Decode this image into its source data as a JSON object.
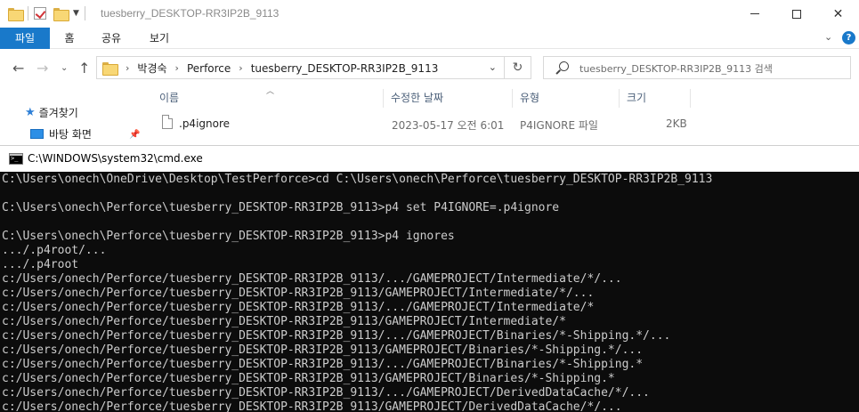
{
  "explorer": {
    "title": "tuesberry_DESKTOP-RR3IP2B_9113",
    "ribbon_tabs": [
      "파일",
      "홈",
      "공유",
      "보기"
    ],
    "address": {
      "crumbs": [
        "박경숙",
        "Perforce",
        "tuesberry_DESKTOP-RR3IP2B_9113"
      ]
    },
    "search": {
      "placeholder": "tuesberry_DESKTOP-RR3IP2B_9113 검색"
    },
    "nav": {
      "items": [
        {
          "label": "즐겨찾기",
          "icon": "star-icon"
        },
        {
          "label": "바탕 화면",
          "icon": "desktop-icon"
        }
      ]
    },
    "columns": [
      "이름",
      "수정한 날짜",
      "유형",
      "크기"
    ],
    "files": [
      {
        "name": ".p4ignore",
        "modified": "2023-05-17 오전 6:01",
        "type": "P4IGNORE 파일",
        "size": "2KB"
      }
    ]
  },
  "cmd": {
    "title": "C:\\WINDOWS\\system32\\cmd.exe",
    "lines": [
      "C:\\Users\\onech\\OneDrive\\Desktop\\TestPerforce>cd C:\\Users\\onech\\Perforce\\tuesberry_DESKTOP-RR3IP2B_9113",
      "",
      "C:\\Users\\onech\\Perforce\\tuesberry_DESKTOP-RR3IP2B_9113>p4 set P4IGNORE=.p4ignore",
      "",
      "C:\\Users\\onech\\Perforce\\tuesberry_DESKTOP-RR3IP2B_9113>p4 ignores",
      ".../.p4root/...",
      ".../.p4root",
      "c:/Users/onech/Perforce/tuesberry_DESKTOP-RR3IP2B_9113/.../GAMEPROJECT/Intermediate/*/...",
      "c:/Users/onech/Perforce/tuesberry_DESKTOP-RR3IP2B_9113/GAMEPROJECT/Intermediate/*/...",
      "c:/Users/onech/Perforce/tuesberry_DESKTOP-RR3IP2B_9113/.../GAMEPROJECT/Intermediate/*",
      "c:/Users/onech/Perforce/tuesberry_DESKTOP-RR3IP2B_9113/GAMEPROJECT/Intermediate/*",
      "c:/Users/onech/Perforce/tuesberry_DESKTOP-RR3IP2B_9113/.../GAMEPROJECT/Binaries/*-Shipping.*/...",
      "c:/Users/onech/Perforce/tuesberry_DESKTOP-RR3IP2B_9113/GAMEPROJECT/Binaries/*-Shipping.*/...",
      "c:/Users/onech/Perforce/tuesberry_DESKTOP-RR3IP2B_9113/.../GAMEPROJECT/Binaries/*-Shipping.*",
      "c:/Users/onech/Perforce/tuesberry_DESKTOP-RR3IP2B_9113/GAMEPROJECT/Binaries/*-Shipping.*",
      "c:/Users/onech/Perforce/tuesberry_DESKTOP-RR3IP2B_9113/.../GAMEPROJECT/DerivedDataCache/*/...",
      "c:/Users/onech/Perforce/tuesberry_DESKTOP-RR3IP2B_9113/GAMEPROJECT/DerivedDataCache/*/..."
    ]
  },
  "colors": {
    "ribbon_file_tab": "#1979ca",
    "console_bg": "#0c0c0c",
    "console_text": "#cccccc"
  }
}
